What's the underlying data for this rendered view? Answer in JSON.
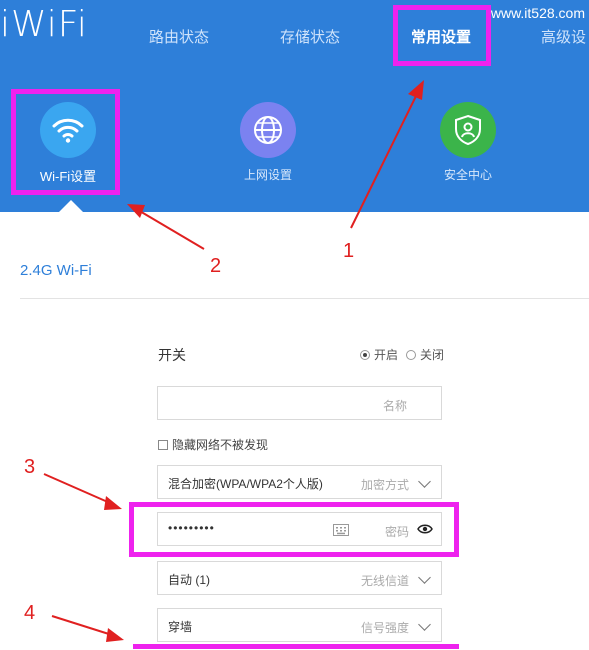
{
  "brand": {
    "logo": "iWiFi",
    "watermark": "www.it528.com"
  },
  "nav": {
    "items": [
      {
        "label": "路由状态"
      },
      {
        "label": "存储状态"
      },
      {
        "label": "常用设置"
      },
      {
        "label": "高级设"
      }
    ],
    "active_index": 2
  },
  "quick_settings": [
    {
      "label": "Wi-Fi设置",
      "icon": "wifi-icon",
      "color": "#3aa6f0"
    },
    {
      "label": "上网设置",
      "icon": "globe-icon",
      "color": "#7b82f0"
    },
    {
      "label": "安全中心",
      "icon": "shield-icon",
      "color": "#3bb44a"
    }
  ],
  "section": {
    "title": "2.4G Wi-Fi"
  },
  "form": {
    "switch_label": "开关",
    "radio_on": "开启",
    "radio_off": "关闭",
    "name_placeholder": "名称",
    "hide_network": "隐藏网络不被发现",
    "encryption": {
      "value": "混合加密(WPA/WPA2个人版)",
      "label": "加密方式"
    },
    "password": {
      "value": "•••••••••",
      "label": "密码"
    },
    "channel": {
      "value": "自动 (1)",
      "label": "无线信道"
    },
    "signal": {
      "value": "穿墙",
      "label": "信号强度"
    }
  },
  "annotations": [
    "1",
    "2",
    "3",
    "4"
  ],
  "colors": {
    "header_blue": "#2e7fd9",
    "highlight": "#ee22ee",
    "annotation_red": "#e02020"
  }
}
